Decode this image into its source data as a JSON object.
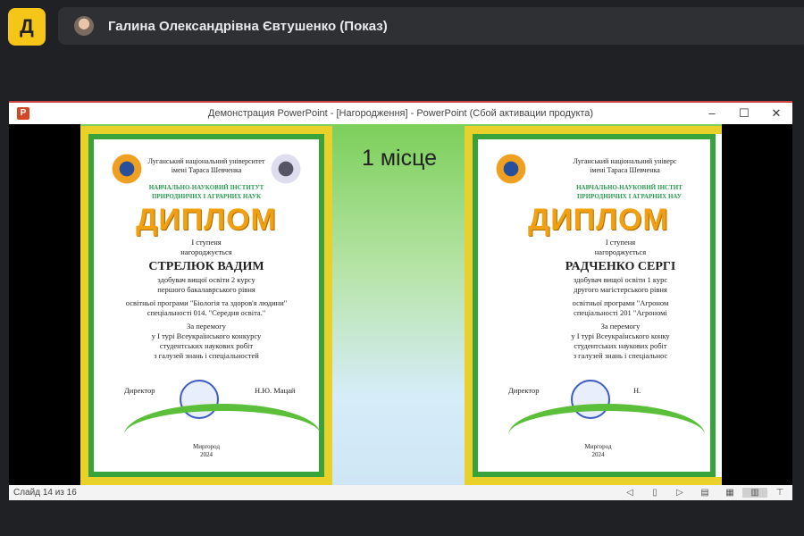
{
  "app": {
    "icon": "meet-app-icon",
    "icon_glyph": "Д"
  },
  "participant": {
    "name": "Галина Олександрівна Євтушенко (Показ)"
  },
  "window": {
    "title": "Демонстрация PowerPoint - [Нагородження] - PowerPoint (Сбой активации продукта)",
    "minimize": "–",
    "maximize": "☐",
    "close": "✕"
  },
  "slide": {
    "place": "1 місце",
    "diplomas": [
      {
        "university": "Луганський національний університет",
        "university2": "імені Тараса Шевченка",
        "institute": "НАВЧАЛЬНО-НАУКОВИЙ ІНСТИТУТ",
        "institute2": "ПРИРОДНИЧИХ І АГРАРНИХ НАУК",
        "title": "ДИПЛОМ",
        "degree": "І ступеня",
        "awarded": "нагороджується",
        "name": "СТРЕЛЮК ВАДИМ",
        "line1": "здобувач вищої освіти 2 курсу",
        "line2": "першого бакалаврського рівня",
        "line3": "освітньої програми \"Біологія та здоров'я людини\"",
        "line4": "спеціальності 014. \"Середня освіта.\"",
        "w1": "За перемогу",
        "w2": "у І турі Всеукраїнського конкурсу",
        "w3": "студентських наукових робіт",
        "w4": "з галузей знань і спеціальностей",
        "director": "Директор",
        "signer": "Н.Ю. Мацай",
        "city": "Миргород",
        "year": "2024"
      },
      {
        "university": "Луганський національний універс",
        "university2": "імені Тараса Шевченка",
        "institute": "НАВЧАЛЬНО-НАУКОВИЙ ІНСТИТ",
        "institute2": "ПРИРОДНИЧИХ І АГРАРНИХ НАУ",
        "title": "ДИПЛОМ",
        "degree": "І ступеня",
        "awarded": "нагороджується",
        "name": "РАДЧЕНКО СЕРГІ",
        "line1": "здобувач вищої освіти 1 курс",
        "line2": "другого магістерського рівня",
        "line3": "освітньої програми \"Агроном",
        "line4": "спеціальності 201 \"Агрономі",
        "w1": "За перемогу",
        "w2": "у І турі Всеукраїнського конку",
        "w3": "студентських наукових робіт",
        "w4": "з галузей знань і спеціальнос",
        "director": "Директор",
        "signer": "Н.",
        "city": "Миргород",
        "year": "2024"
      }
    ]
  },
  "status": {
    "slide": "Слайд 14 из 16"
  }
}
